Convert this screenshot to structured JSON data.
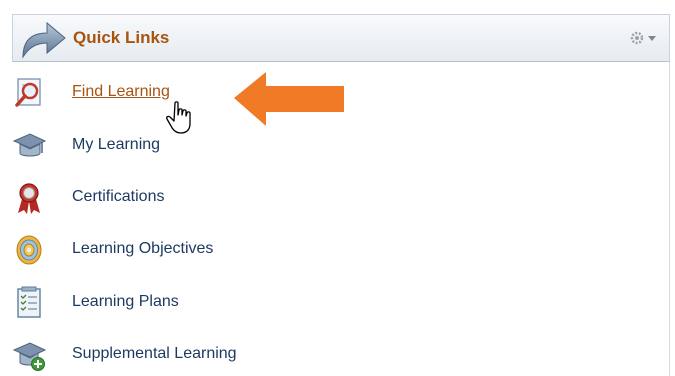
{
  "header": {
    "title": "Quick Links",
    "icon": "back-arrow-icon",
    "menu_icon": "gear-icon"
  },
  "items": [
    {
      "label": "Find Learning",
      "icon": "magnifier-document-icon",
      "active": true
    },
    {
      "label": "My Learning",
      "icon": "graduation-cap-icon",
      "active": false
    },
    {
      "label": "Certifications",
      "icon": "award-ribbon-icon",
      "active": false
    },
    {
      "label": "Learning Objectives",
      "icon": "target-icon",
      "active": false
    },
    {
      "label": "Learning Plans",
      "icon": "checklist-icon",
      "active": false
    },
    {
      "label": "Supplemental Learning",
      "icon": "graduation-cap-add-icon",
      "active": false
    }
  ],
  "colors": {
    "accent": "#a8530e",
    "link": "#1d3a63",
    "arrow": "#f07a26"
  }
}
